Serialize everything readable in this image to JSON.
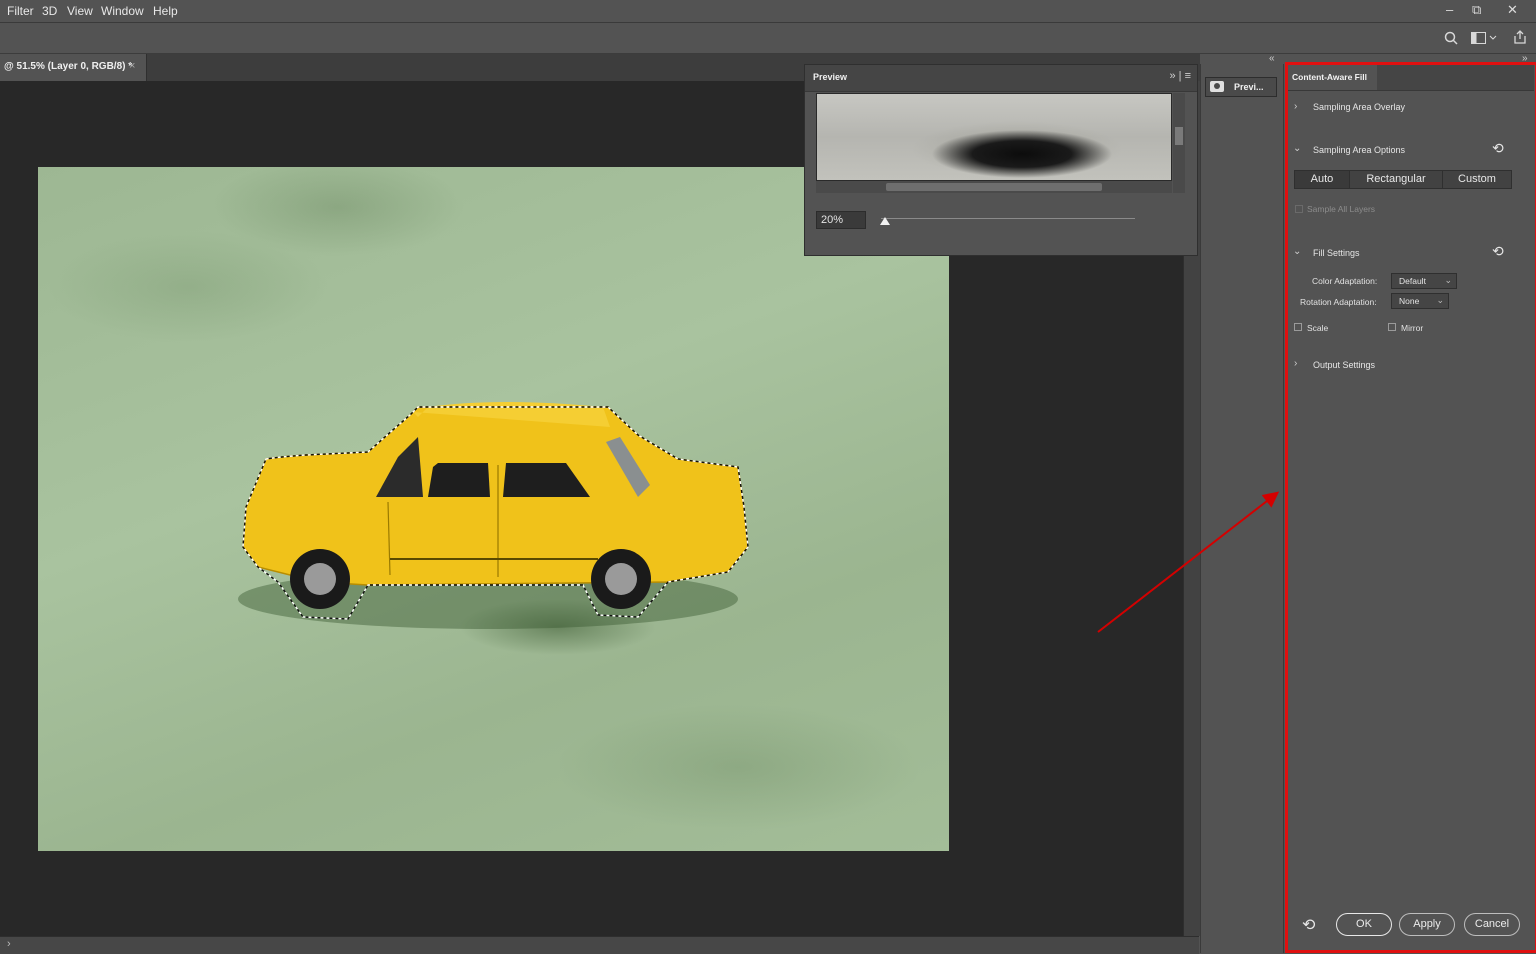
{
  "menu": [
    "Filter",
    "3D",
    "View",
    "Window",
    "Help"
  ],
  "window_controls": {
    "minimize": "–",
    "restore": "⧉",
    "close": "✕"
  },
  "document_tab": {
    "label": "@ 51.5% (Layer 0, RGB/8) *",
    "close": "×"
  },
  "preview_panel": {
    "title": "Preview",
    "menu_icons": "»  |  ≡",
    "zoom_value": "20%",
    "zoom_level": 0.02
  },
  "dock": {
    "collapse": "«",
    "preview_button": "Previ..."
  },
  "content_aware_fill": {
    "collapse": "»",
    "title": "Content-Aware Fill",
    "sections": {
      "sampling_area_overlay": "Sampling Area Overlay",
      "sampling_area_options": "Sampling Area Options",
      "fill_settings": "Fill Settings",
      "output_settings": "Output Settings"
    },
    "sampling_modes": [
      "Auto",
      "Rectangular",
      "Custom"
    ],
    "sampling_mode_selected": "Auto",
    "sample_all_layers": "Sample All Layers",
    "color_adaptation": {
      "label": "Color Adaptation:",
      "value": "Default"
    },
    "rotation_adaptation": {
      "label": "Rotation Adaptation:",
      "value": "None"
    },
    "scale": "Scale",
    "mirror": "Mirror",
    "buttons": {
      "ok": "OK",
      "apply": "Apply",
      "cancel": "Cancel"
    }
  },
  "colors": {
    "highlight": "#e01010",
    "arrow": "#d40000",
    "car": "#f0c21a"
  },
  "icons": {
    "search": "search-icon",
    "workspace": "workspace-icon",
    "share": "share-icon",
    "reset": "reset-icon"
  }
}
